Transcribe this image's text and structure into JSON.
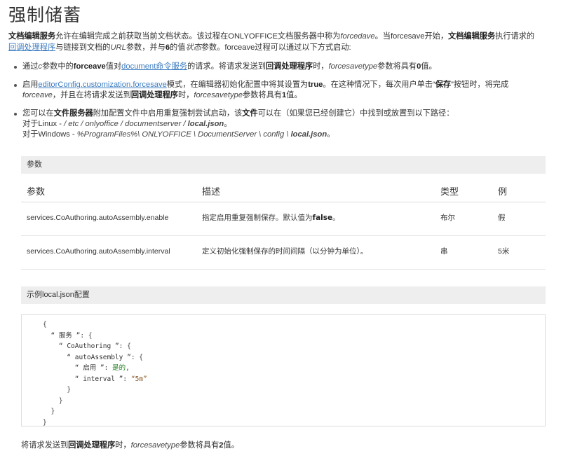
{
  "title": "强制储蓄",
  "intro": {
    "p1_bold": "文档编辑服务",
    "p1_text": "允许在编辑完成之前获取当前文档状态。该过程在ONLYOFFICE文档服务器中称为",
    "p1_italic": "forcedave",
    "p1_text2": "。当forcesave开始，",
    "p1_bold2": "文档编辑服务",
    "p1_text3": "执行请求的",
    "link_callback": "回调处理程序",
    "p1_text4": "与链接到文档的",
    "p1_italic2": "URL",
    "p1_text5": "参数，并与",
    "p1_bold3": "6",
    "p1_text6": "的值",
    "p1_italic3": "状态",
    "p1_text7": "参数。forceave过程可以通过以下方式启动:"
  },
  "bullets": {
    "b1": {
      "t1": "通过",
      "i1": "c",
      "t2": "参数中的",
      "bold1": "forceave",
      "t3": "值对",
      "link": "document命令服务",
      "t4": "的请求。将请求发送到",
      "bold2": "回调处理程序",
      "t5": "时，",
      "i2": "forcesavetype",
      "t6": "参数将具有",
      "bold3": "0",
      "t7": "值。"
    },
    "b2": {
      "t1": "启用",
      "link": "editorConfig.customization.forcesave",
      "t2": "模式，在编辑器初始化配置中将其设置为",
      "bold1": "true",
      "t3": "。在这种情况下，每次用户单击“",
      "bold2": "保存",
      "t4": "”按钮时，将完成",
      "i1": "forceave",
      "t5": "，并且在将请求发送到",
      "bold3": "回调处理程序",
      "t6": "时，",
      "i2": "forcesavetype",
      "t7": "参数将具有",
      "bold4": "1",
      "t8": "值。"
    },
    "b3": {
      "t1": "您可以在",
      "bold1": "文件服务器",
      "t2": "附加配置文件中启用重复强制尝试启动，该",
      "bold2": "文件",
      "t3": "可以在（如果您已经创建它）中找到或放置到以下路径：",
      "linux_label": "对于Linux - ",
      "linux_path": "/ etc / onlyoffice / documentserver / ",
      "linux_file": "local.json",
      "linux_end": "。",
      "windows_label": "对于Windows - ",
      "windows_path": "%ProgramFiles%\\ ONLYOFFICE \\ DocumentServer \\ config \\ ",
      "windows_file": "local.json",
      "windows_end": "。"
    }
  },
  "params_section": {
    "bar_label": "参数",
    "headers": [
      "参数",
      "描述",
      "类型",
      "例"
    ],
    "rows": [
      {
        "param": "services.CoAuthoring.autoAssembly.enable",
        "desc": "指定启用重复强制保存。默认值为",
        "desc_bold": "false",
        "desc_end": "。",
        "type": "布尔",
        "example": "假"
      },
      {
        "param": "services.CoAuthoring.autoAssembly.interval",
        "desc": "定义初始化强制保存的时间间隔（以分钟为单位）。",
        "desc_bold": "",
        "desc_end": "",
        "type": "串",
        "example": "5米"
      }
    ]
  },
  "example_section": {
    "bar_label": "示例local.json配置",
    "code": {
      "l1": "{",
      "l2_key": "  “ 服务 ”",
      "l2_rest": ": {",
      "l3_key": "    “ CoAuthoring ”",
      "l3_rest": ": {",
      "l4_key": "      “ autoAssembly ”",
      "l4_rest": ": {",
      "l5_key": "        “ 启用 ”",
      "l5_colon": ": ",
      "l5_val": "是的",
      "l5_end": ",",
      "l6_key": "        “ interval ”",
      "l6_colon": ": ",
      "l6_val": "“5m”",
      "l7": "      }",
      "l8": "    }",
      "l9": "  }",
      "l10": "}"
    }
  },
  "footer": {
    "t1": "将请求发送到",
    "bold1": "回调处理程序",
    "t2": "时，",
    "i1": "forcesavetype",
    "t3": "参数将具有",
    "bold2": "2",
    "t4": "值。"
  }
}
